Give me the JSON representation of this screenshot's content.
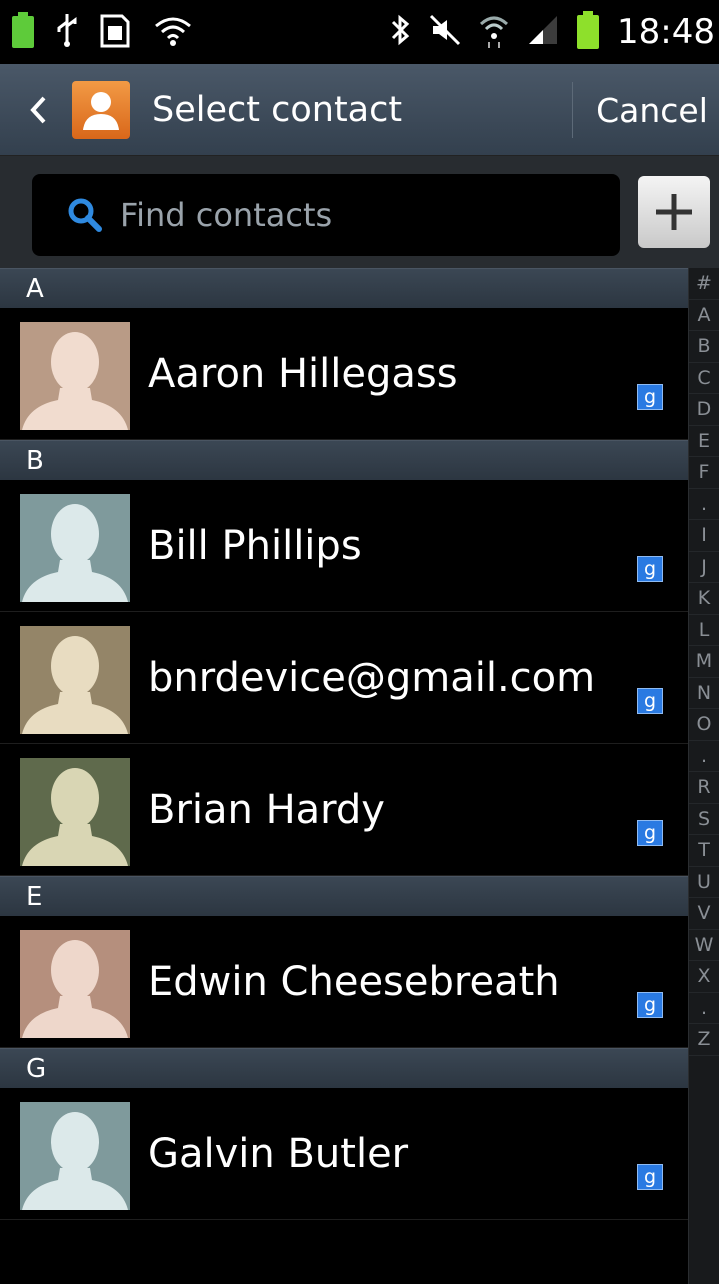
{
  "status_bar": {
    "time": "18:48",
    "battery_percent_label": "100%",
    "icons_left": [
      "battery-icon",
      "usb-icon",
      "sd-card-icon",
      "wifi-alert-icon"
    ],
    "icons_right": [
      "bluetooth-icon",
      "mute-icon",
      "wifi-icon",
      "signal-icon",
      "battery-icon"
    ]
  },
  "action_bar": {
    "title": "Select contact",
    "cancel_label": "Cancel"
  },
  "search": {
    "placeholder": "Find contacts"
  },
  "colors": {
    "accent_orange": "#e8842f",
    "google_badge": "#2a7ae2",
    "section_header": "#33404e"
  },
  "sections": [
    {
      "letter": "A",
      "contacts": [
        {
          "name": "Aaron Hillegass",
          "avatar_bg": "#b99b86",
          "avatar_fg": "#f1dccf",
          "source": "google"
        }
      ]
    },
    {
      "letter": "B",
      "contacts": [
        {
          "name": "Bill Phillips",
          "avatar_bg": "#7f9a9c",
          "avatar_fg": "#dce9ea",
          "source": "google"
        },
        {
          "name": "bnrdevice@gmail.com",
          "avatar_bg": "#948568",
          "avatar_fg": "#e8dcc1",
          "source": "google"
        },
        {
          "name": "Brian Hardy",
          "avatar_bg": "#5f6a4c",
          "avatar_fg": "#d9d6b4",
          "source": "google"
        }
      ]
    },
    {
      "letter": "E",
      "contacts": [
        {
          "name": "Edwin Cheesebreath",
          "avatar_bg": "#b58f7d",
          "avatar_fg": "#eed7cb",
          "source": "google"
        }
      ]
    },
    {
      "letter": "G",
      "contacts": [
        {
          "name": "Galvin Butler",
          "avatar_bg": "#7f9a9c",
          "avatar_fg": "#dce9ea",
          "source": "google"
        }
      ]
    }
  ],
  "index_rail": [
    "#",
    "A",
    "B",
    "C",
    "D",
    "E",
    "F",
    ".",
    "I",
    "J",
    "K",
    "L",
    "M",
    "N",
    "O",
    ".",
    "R",
    "S",
    "T",
    "U",
    "V",
    "W",
    "X",
    ".",
    "Z"
  ],
  "badge_label": "g"
}
